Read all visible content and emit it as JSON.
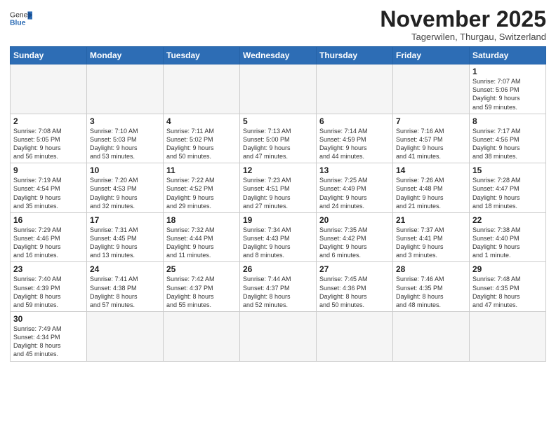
{
  "header": {
    "logo_general": "General",
    "logo_blue": "Blue",
    "title": "November 2025",
    "subtitle": "Tagerwilen, Thurgau, Switzerland"
  },
  "weekdays": [
    "Sunday",
    "Monday",
    "Tuesday",
    "Wednesday",
    "Thursday",
    "Friday",
    "Saturday"
  ],
  "weeks": [
    [
      {
        "day": "",
        "empty": true
      },
      {
        "day": "",
        "empty": true
      },
      {
        "day": "",
        "empty": true
      },
      {
        "day": "",
        "empty": true
      },
      {
        "day": "",
        "empty": true
      },
      {
        "day": "",
        "empty": true
      },
      {
        "day": "1",
        "info": "Sunrise: 7:07 AM\nSunset: 5:06 PM\nDaylight: 9 hours\nand 59 minutes."
      }
    ],
    [
      {
        "day": "2",
        "info": "Sunrise: 7:08 AM\nSunset: 5:05 PM\nDaylight: 9 hours\nand 56 minutes."
      },
      {
        "day": "3",
        "info": "Sunrise: 7:10 AM\nSunset: 5:03 PM\nDaylight: 9 hours\nand 53 minutes."
      },
      {
        "day": "4",
        "info": "Sunrise: 7:11 AM\nSunset: 5:02 PM\nDaylight: 9 hours\nand 50 minutes."
      },
      {
        "day": "5",
        "info": "Sunrise: 7:13 AM\nSunset: 5:00 PM\nDaylight: 9 hours\nand 47 minutes."
      },
      {
        "day": "6",
        "info": "Sunrise: 7:14 AM\nSunset: 4:59 PM\nDaylight: 9 hours\nand 44 minutes."
      },
      {
        "day": "7",
        "info": "Sunrise: 7:16 AM\nSunset: 4:57 PM\nDaylight: 9 hours\nand 41 minutes."
      },
      {
        "day": "8",
        "info": "Sunrise: 7:17 AM\nSunset: 4:56 PM\nDaylight: 9 hours\nand 38 minutes."
      }
    ],
    [
      {
        "day": "9",
        "info": "Sunrise: 7:19 AM\nSunset: 4:54 PM\nDaylight: 9 hours\nand 35 minutes."
      },
      {
        "day": "10",
        "info": "Sunrise: 7:20 AM\nSunset: 4:53 PM\nDaylight: 9 hours\nand 32 minutes."
      },
      {
        "day": "11",
        "info": "Sunrise: 7:22 AM\nSunset: 4:52 PM\nDaylight: 9 hours\nand 29 minutes."
      },
      {
        "day": "12",
        "info": "Sunrise: 7:23 AM\nSunset: 4:51 PM\nDaylight: 9 hours\nand 27 minutes."
      },
      {
        "day": "13",
        "info": "Sunrise: 7:25 AM\nSunset: 4:49 PM\nDaylight: 9 hours\nand 24 minutes."
      },
      {
        "day": "14",
        "info": "Sunrise: 7:26 AM\nSunset: 4:48 PM\nDaylight: 9 hours\nand 21 minutes."
      },
      {
        "day": "15",
        "info": "Sunrise: 7:28 AM\nSunset: 4:47 PM\nDaylight: 9 hours\nand 18 minutes."
      }
    ],
    [
      {
        "day": "16",
        "info": "Sunrise: 7:29 AM\nSunset: 4:46 PM\nDaylight: 9 hours\nand 16 minutes."
      },
      {
        "day": "17",
        "info": "Sunrise: 7:31 AM\nSunset: 4:45 PM\nDaylight: 9 hours\nand 13 minutes."
      },
      {
        "day": "18",
        "info": "Sunrise: 7:32 AM\nSunset: 4:44 PM\nDaylight: 9 hours\nand 11 minutes."
      },
      {
        "day": "19",
        "info": "Sunrise: 7:34 AM\nSunset: 4:43 PM\nDaylight: 9 hours\nand 8 minutes."
      },
      {
        "day": "20",
        "info": "Sunrise: 7:35 AM\nSunset: 4:42 PM\nDaylight: 9 hours\nand 6 minutes."
      },
      {
        "day": "21",
        "info": "Sunrise: 7:37 AM\nSunset: 4:41 PM\nDaylight: 9 hours\nand 3 minutes."
      },
      {
        "day": "22",
        "info": "Sunrise: 7:38 AM\nSunset: 4:40 PM\nDaylight: 9 hours\nand 1 minute."
      }
    ],
    [
      {
        "day": "23",
        "info": "Sunrise: 7:40 AM\nSunset: 4:39 PM\nDaylight: 8 hours\nand 59 minutes."
      },
      {
        "day": "24",
        "info": "Sunrise: 7:41 AM\nSunset: 4:38 PM\nDaylight: 8 hours\nand 57 minutes."
      },
      {
        "day": "25",
        "info": "Sunrise: 7:42 AM\nSunset: 4:37 PM\nDaylight: 8 hours\nand 55 minutes."
      },
      {
        "day": "26",
        "info": "Sunrise: 7:44 AM\nSunset: 4:37 PM\nDaylight: 8 hours\nand 52 minutes."
      },
      {
        "day": "27",
        "info": "Sunrise: 7:45 AM\nSunset: 4:36 PM\nDaylight: 8 hours\nand 50 minutes."
      },
      {
        "day": "28",
        "info": "Sunrise: 7:46 AM\nSunset: 4:35 PM\nDaylight: 8 hours\nand 48 minutes."
      },
      {
        "day": "29",
        "info": "Sunrise: 7:48 AM\nSunset: 4:35 PM\nDaylight: 8 hours\nand 47 minutes."
      }
    ],
    [
      {
        "day": "30",
        "info": "Sunrise: 7:49 AM\nSunset: 4:34 PM\nDaylight: 8 hours\nand 45 minutes."
      },
      {
        "day": "",
        "empty": true
      },
      {
        "day": "",
        "empty": true
      },
      {
        "day": "",
        "empty": true
      },
      {
        "day": "",
        "empty": true
      },
      {
        "day": "",
        "empty": true
      },
      {
        "day": "",
        "empty": true
      }
    ]
  ]
}
